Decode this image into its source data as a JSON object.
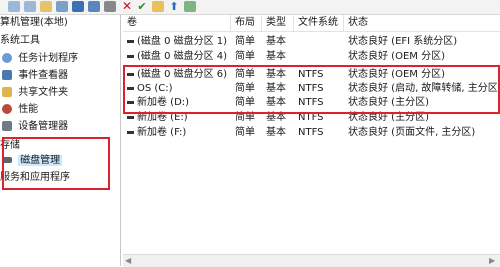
{
  "tree": {
    "items": [
      {
        "label": "算机管理(本地)",
        "icon": "computer-icon"
      },
      {
        "label": "系统工具",
        "icon": "tools-icon"
      },
      {
        "label": "任务计划程序",
        "icon": "clock-icon"
      },
      {
        "label": "事件查看器",
        "icon": "event-viewer-icon"
      },
      {
        "label": "共享文件夹",
        "icon": "shared-folder-icon"
      },
      {
        "label": "性能",
        "icon": "performance-icon"
      },
      {
        "label": "设备管理器",
        "icon": "device-manager-icon"
      },
      {
        "label": "存储",
        "icon": "storage-icon"
      },
      {
        "label": "磁盘管理",
        "icon": "disk-management-icon"
      },
      {
        "label": "服务和应用程序",
        "icon": "services-icon"
      }
    ]
  },
  "list": {
    "columns": [
      "卷",
      "布局",
      "类型",
      "文件系统",
      "状态"
    ],
    "rows": [
      {
        "vol": "(磁盘 0 磁盘分区 1)",
        "layout": "简单",
        "type": "基本",
        "fs": "",
        "status": "状态良好 (EFI 系统分区)"
      },
      {
        "vol": "(磁盘 0 磁盘分区 4)",
        "layout": "简单",
        "type": "基本",
        "fs": "",
        "status": "状态良好 (OEM 分区)"
      },
      {
        "vol": "(磁盘 0 磁盘分区 6)",
        "layout": "简单",
        "type": "基本",
        "fs": "NTFS",
        "status": "状态良好 (OEM 分区)"
      },
      {
        "vol": "OS (C:)",
        "layout": "简单",
        "type": "基本",
        "fs": "NTFS",
        "status": "状态良好 (启动, 故障转储, 主分区)"
      },
      {
        "vol": "新加卷 (D:)",
        "layout": "简单",
        "type": "基本",
        "fs": "NTFS",
        "status": "状态良好 (主分区)"
      },
      {
        "vol": "新加卷 (E:)",
        "layout": "简单",
        "type": "基本",
        "fs": "NTFS",
        "status": "状态良好 (主分区)"
      },
      {
        "vol": "新加卷 (F:)",
        "layout": "简单",
        "type": "基本",
        "fs": "NTFS",
        "status": "状态良好 (页面文件, 主分区)"
      }
    ]
  },
  "colors": {
    "highlight": "#d9232d",
    "selection": "#cce8ff",
    "close_icon": "#c8101e"
  }
}
